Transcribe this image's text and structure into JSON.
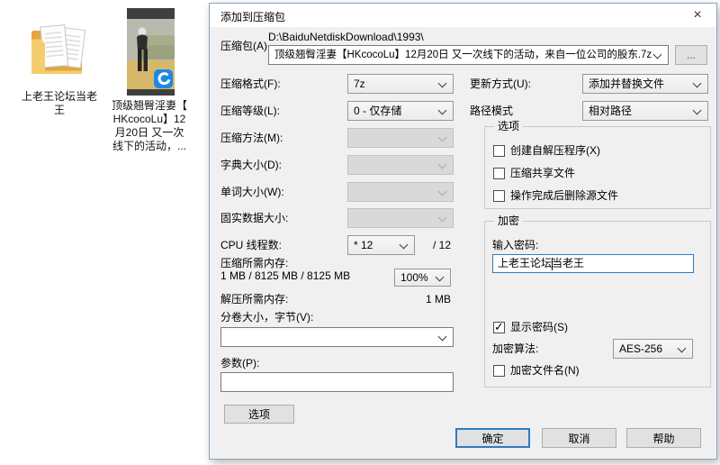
{
  "colors": {
    "accent_blue": "#2f7bbf",
    "badge_blue": "#1e88e5",
    "dialog_bg": "#f0f0f0"
  },
  "desktop": {
    "folder_icon": {
      "label_line1": "上老王论坛当老",
      "label_line2": "王"
    },
    "video_icon": {
      "label_line1": "顶级翘臀淫妻【",
      "label_line2": "HKcocoLu】12",
      "label_line3": "月20日 又一次",
      "label_line4": "线下的活动，..."
    }
  },
  "dialog": {
    "title": "添加到压缩包",
    "close_glyph": "×",
    "archive": {
      "label": "压缩包(A)",
      "dir_path": "D:\\BaiduNetdiskDownload\\1993\\",
      "filename": "顶级翘臀淫妻【HKcocoLu】12月20日 又一次线下的活动，来自一位公司的股东.7z",
      "browse": "..."
    },
    "left": {
      "format_label": "压缩格式(F):",
      "format_value": "7z",
      "level_label": "压缩等级(L):",
      "level_value": "0 - 仅存储",
      "method_label": "压缩方法(M):",
      "method_value": "",
      "dict_label": "字典大小(D):",
      "dict_value": "",
      "word_label": "单词大小(W):",
      "word_value": "",
      "solid_label": "固实数据大小:",
      "solid_value": "",
      "cpu_label": "CPU 线程数:",
      "cpu_value": "* 12",
      "cpu_max": "/ 12",
      "mem_compress_label": "压缩所需内存:",
      "mem_compress_detail": "1 MB / 8125 MB / 8125 MB",
      "mem_percent": "100%",
      "mem_decompress_label": "解压所需内存:",
      "mem_decompress_value": "1 MB",
      "split_label": "分卷大小，字节(V):",
      "split_value": "",
      "params_label": "参数(P):",
      "params_value": "",
      "options_button": "选项"
    },
    "right": {
      "update_label": "更新方式(U):",
      "update_value": "添加并替换文件",
      "pathmode_label": "路径模式",
      "pathmode_value": "相对路径",
      "options_group_title": "选项",
      "cb_sfx": {
        "label": "创建自解压程序(X)",
        "checked": false
      },
      "cb_shared": {
        "label": "压缩共享文件",
        "checked": false
      },
      "cb_delete": {
        "label": "操作完成后删除源文件",
        "checked": false
      },
      "encrypt_group_title": "加密",
      "password_label": "输入密码:",
      "password_value": "上老王论坛当老王",
      "cb_show_password": {
        "label": "显示密码(S)",
        "checked": true
      },
      "enc_method_label": "加密算法:",
      "enc_method_value": "AES-256",
      "cb_encrypt_names": {
        "label": "加密文件名(N)",
        "checked": false
      }
    },
    "buttons": {
      "ok": "确定",
      "cancel": "取消",
      "help": "帮助"
    }
  }
}
